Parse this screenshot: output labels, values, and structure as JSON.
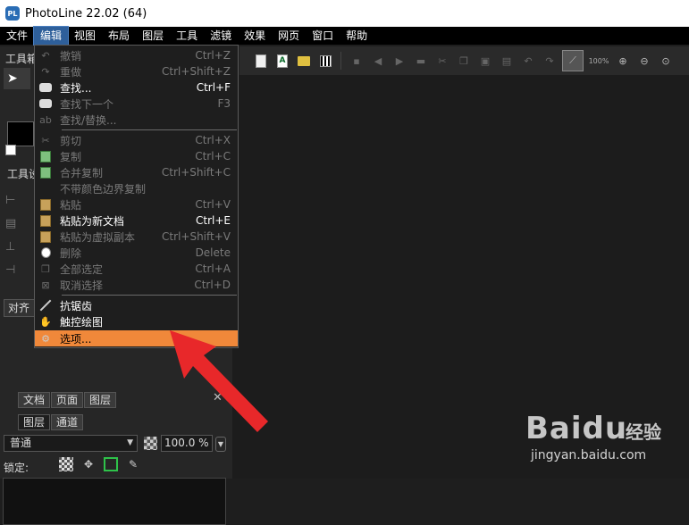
{
  "titlebar": {
    "app_icon": "PL",
    "title": "PhotoLine 22.02 (64)"
  },
  "menubar": {
    "items": [
      "文件",
      "编辑",
      "视图",
      "布局",
      "图层",
      "工具",
      "滤镜",
      "效果",
      "网页",
      "窗口",
      "帮助"
    ],
    "active_index": 1
  },
  "toolbar": {
    "zoom": "100%"
  },
  "leftpanel": {
    "tab_tools": "工具箱",
    "tab_tools2": "工具设",
    "align_label": "对齐",
    "doc_tabs": [
      "文档",
      "页面",
      "图层"
    ],
    "layer_tabs": [
      "图层",
      "通道"
    ],
    "blend_mode": "普通",
    "opacity": "100.0 %",
    "lock_label": "锁定:"
  },
  "edit_menu": {
    "items": [
      {
        "label": "撤销",
        "shortcut": "Ctrl+Z",
        "icon": "undo-icon",
        "enabled": false
      },
      {
        "label": "重做",
        "shortcut": "Ctrl+Shift+Z",
        "icon": "redo-icon",
        "enabled": false
      },
      {
        "label": "查找...",
        "shortcut": "Ctrl+F",
        "icon": "binoculars-icon",
        "enabled": true
      },
      {
        "label": "查找下一个",
        "shortcut": "F3",
        "icon": "binoculars-icon",
        "enabled": false
      },
      {
        "label": "查找/替换...",
        "shortcut": "",
        "icon": "find-replace-icon",
        "enabled": false
      },
      {
        "label": "剪切",
        "shortcut": "Ctrl+X",
        "icon": "scissors-icon",
        "enabled": false
      },
      {
        "label": "复制",
        "shortcut": "Ctrl+C",
        "icon": "copy-icon",
        "enabled": false
      },
      {
        "label": "合并复制",
        "shortcut": "Ctrl+Shift+C",
        "icon": "merge-copy-icon",
        "enabled": false
      },
      {
        "label": "不带颜色边界复制",
        "shortcut": "",
        "icon": "",
        "enabled": false
      },
      {
        "label": "粘贴",
        "shortcut": "Ctrl+V",
        "icon": "paste-icon",
        "enabled": false
      },
      {
        "label": "粘贴为新文档",
        "shortcut": "Ctrl+E",
        "icon": "paste-new-icon",
        "enabled": true
      },
      {
        "label": "粘贴为虚拟副本",
        "shortcut": "Ctrl+Shift+V",
        "icon": "paste-virtual-icon",
        "enabled": false
      },
      {
        "label": "删除",
        "shortcut": "Delete",
        "icon": "trash-icon",
        "enabled": false
      },
      {
        "label": "全部选定",
        "shortcut": "Ctrl+A",
        "icon": "select-all-icon",
        "enabled": false
      },
      {
        "label": "取消选择",
        "shortcut": "Ctrl+D",
        "icon": "deselect-icon",
        "enabled": false
      },
      {
        "label": "抗锯齿",
        "shortcut": "",
        "icon": "antialias-icon",
        "enabled": true
      },
      {
        "label": "触控绘图",
        "shortcut": "",
        "icon": "touch-draw-icon",
        "enabled": true
      },
      {
        "label": "选项...",
        "shortcut": "",
        "icon": "gear-icon",
        "enabled": true,
        "highlighted": true
      }
    ]
  },
  "watermark": {
    "logo": "Baidu",
    "cn": "经验",
    "url": "jingyan.baidu.com"
  },
  "colors": {
    "menu_highlight": "#f0883a",
    "arrow": "#e8282a",
    "active_menu": "#2e5f9a"
  }
}
